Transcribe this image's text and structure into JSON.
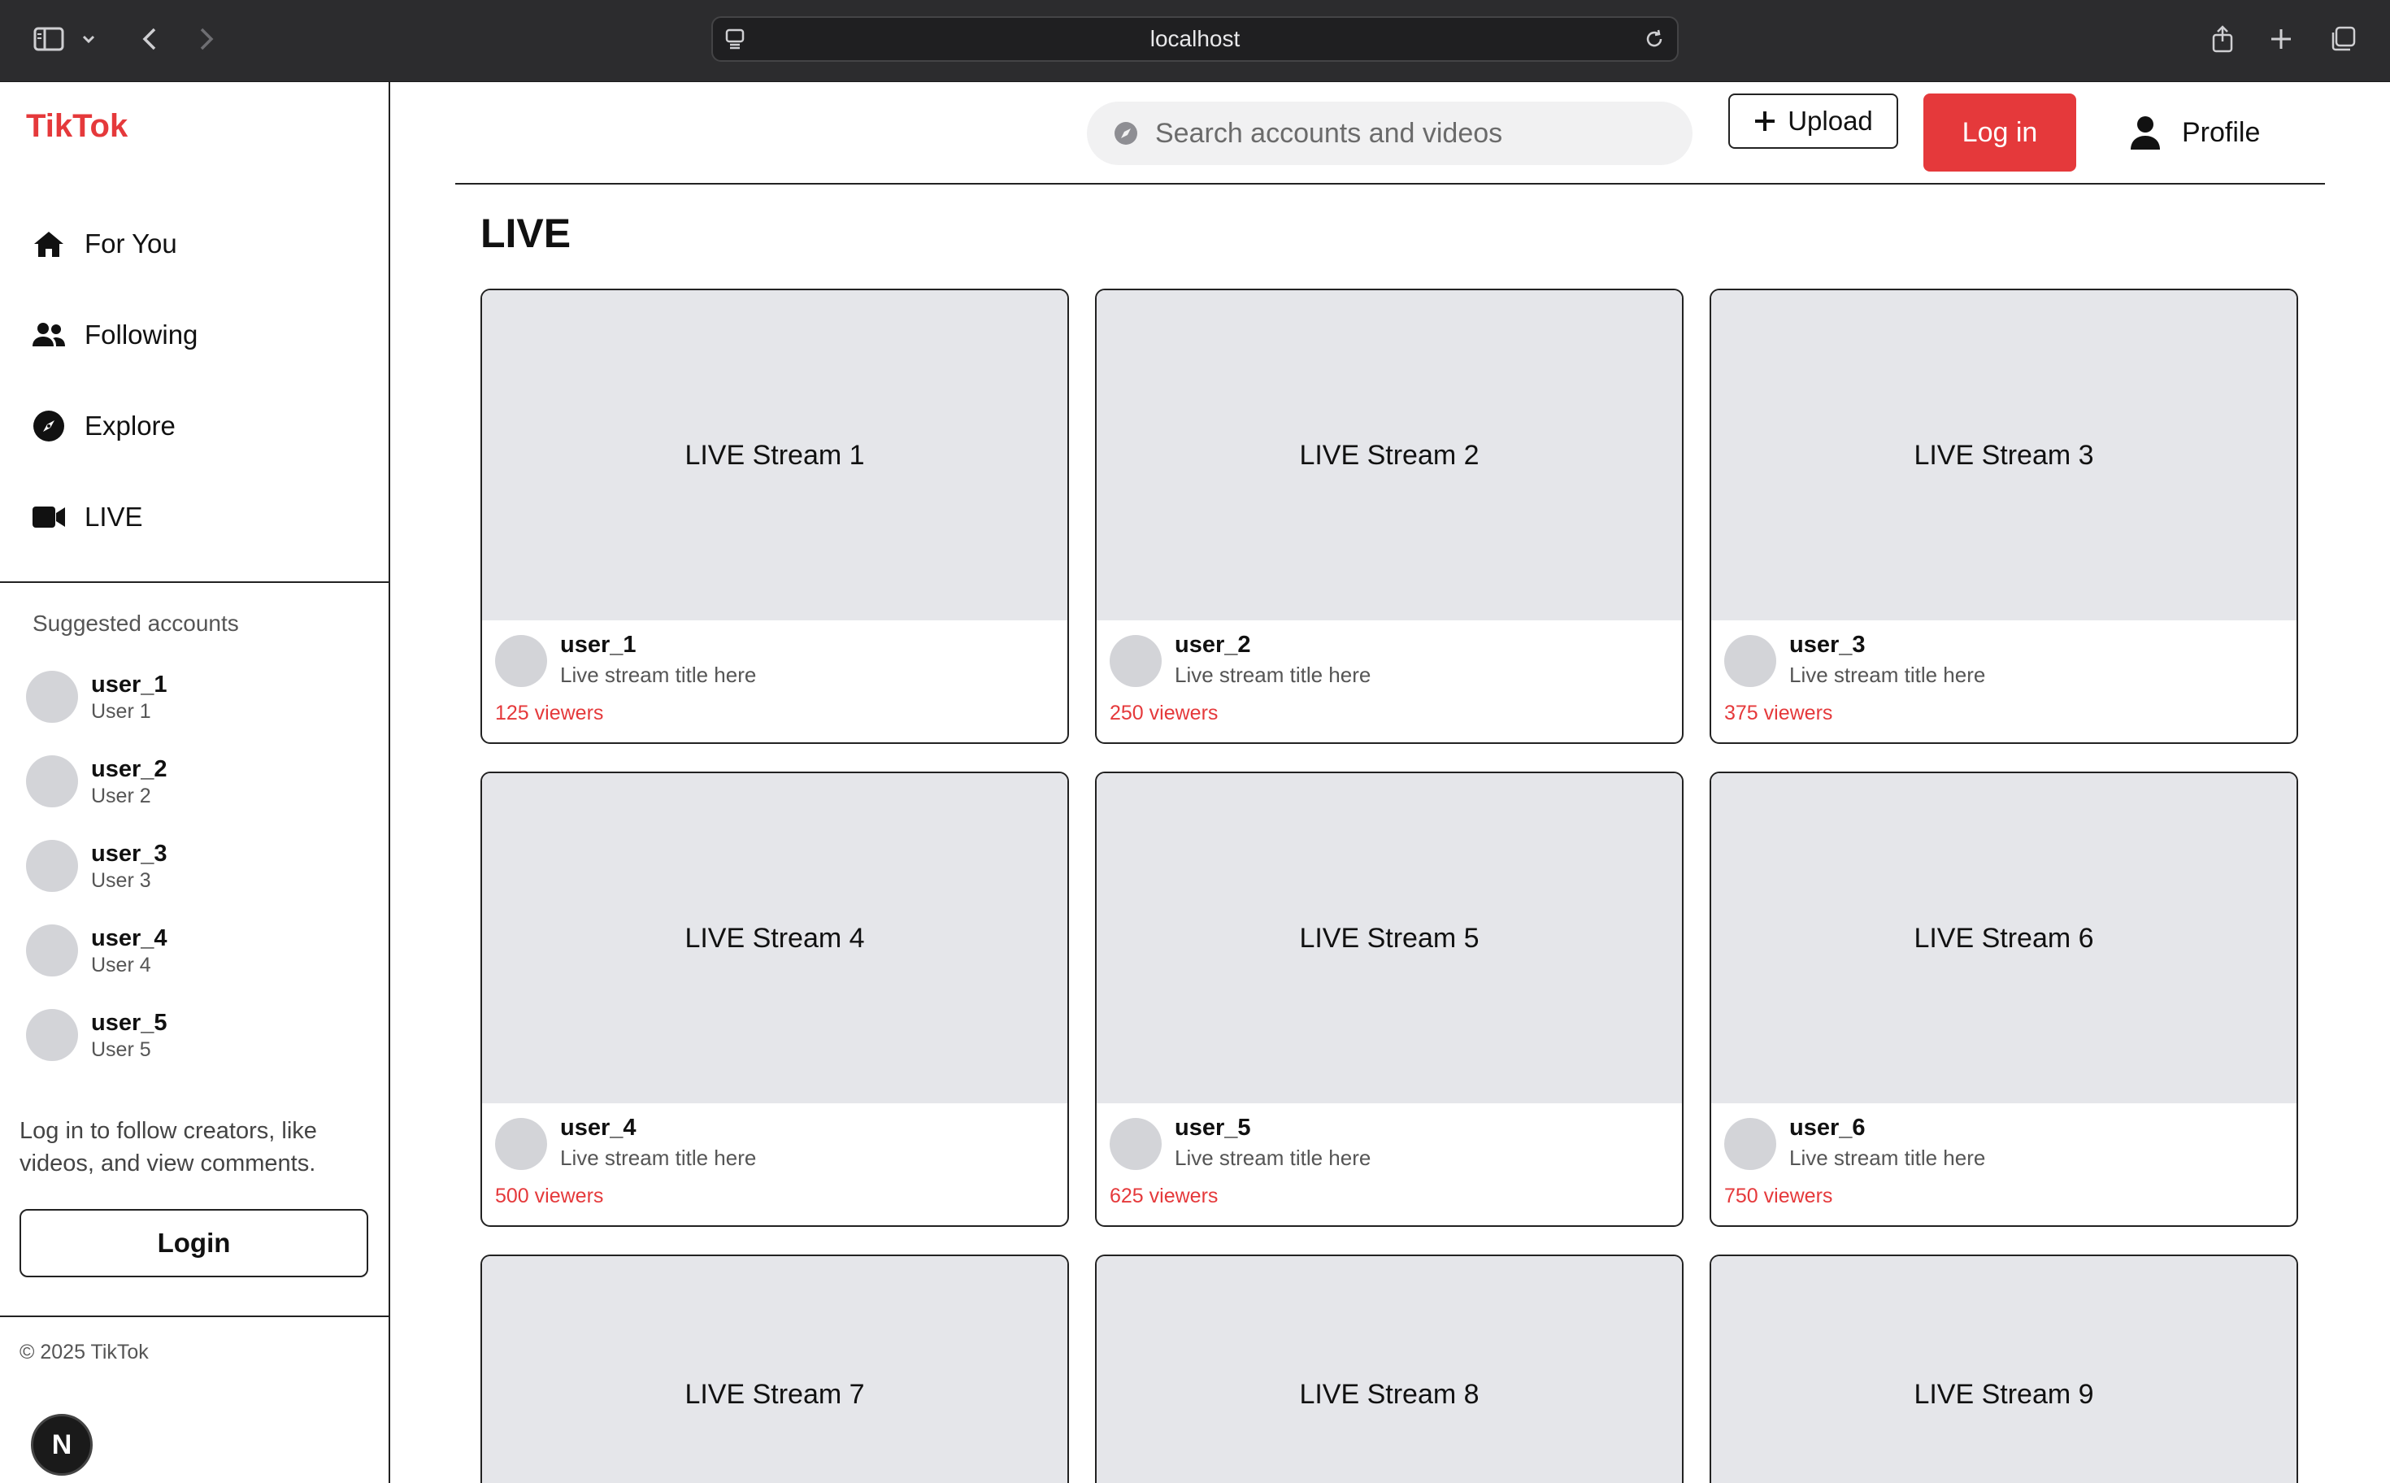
{
  "browser": {
    "url": "localhost"
  },
  "sidebar": {
    "logo": "TikTok",
    "nav": [
      {
        "label": "For You",
        "icon": "home-icon"
      },
      {
        "label": "Following",
        "icon": "users-icon"
      },
      {
        "label": "Explore",
        "icon": "compass-icon"
      },
      {
        "label": "LIVE",
        "icon": "video-icon"
      }
    ],
    "suggested_title": "Suggested accounts",
    "suggested": [
      {
        "username": "user_1",
        "display": "User 1"
      },
      {
        "username": "user_2",
        "display": "User 2"
      },
      {
        "username": "user_3",
        "display": "User 3"
      },
      {
        "username": "user_4",
        "display": "User 4"
      },
      {
        "username": "user_5",
        "display": "User 5"
      }
    ],
    "login_prompt": "Log in to follow creators, like videos, and view comments.",
    "login_button": "Login",
    "copyright": "© 2025 TikTok",
    "badge": "N"
  },
  "header": {
    "search_placeholder": "Search accounts and videos",
    "upload_label": "Upload",
    "login_label": "Log in",
    "profile_label": "Profile"
  },
  "main": {
    "title": "LIVE",
    "streams": [
      {
        "thumb": "LIVE Stream 1",
        "user": "user_1",
        "title": "Live stream title here",
        "viewers": "125 viewers"
      },
      {
        "thumb": "LIVE Stream 2",
        "user": "user_2",
        "title": "Live stream title here",
        "viewers": "250 viewers"
      },
      {
        "thumb": "LIVE Stream 3",
        "user": "user_3",
        "title": "Live stream title here",
        "viewers": "375 viewers"
      },
      {
        "thumb": "LIVE Stream 4",
        "user": "user_4",
        "title": "Live stream title here",
        "viewers": "500 viewers"
      },
      {
        "thumb": "LIVE Stream 5",
        "user": "user_5",
        "title": "Live stream title here",
        "viewers": "625 viewers"
      },
      {
        "thumb": "LIVE Stream 6",
        "user": "user_6",
        "title": "Live stream title here",
        "viewers": "750 viewers"
      },
      {
        "thumb": "LIVE Stream 7"
      },
      {
        "thumb": "LIVE Stream 8"
      },
      {
        "thumb": "LIVE Stream 9"
      }
    ]
  },
  "colors": {
    "brand": "#e5393b",
    "chrome": "#2c2c2e",
    "thumb_bg": "#e5e6ea"
  }
}
